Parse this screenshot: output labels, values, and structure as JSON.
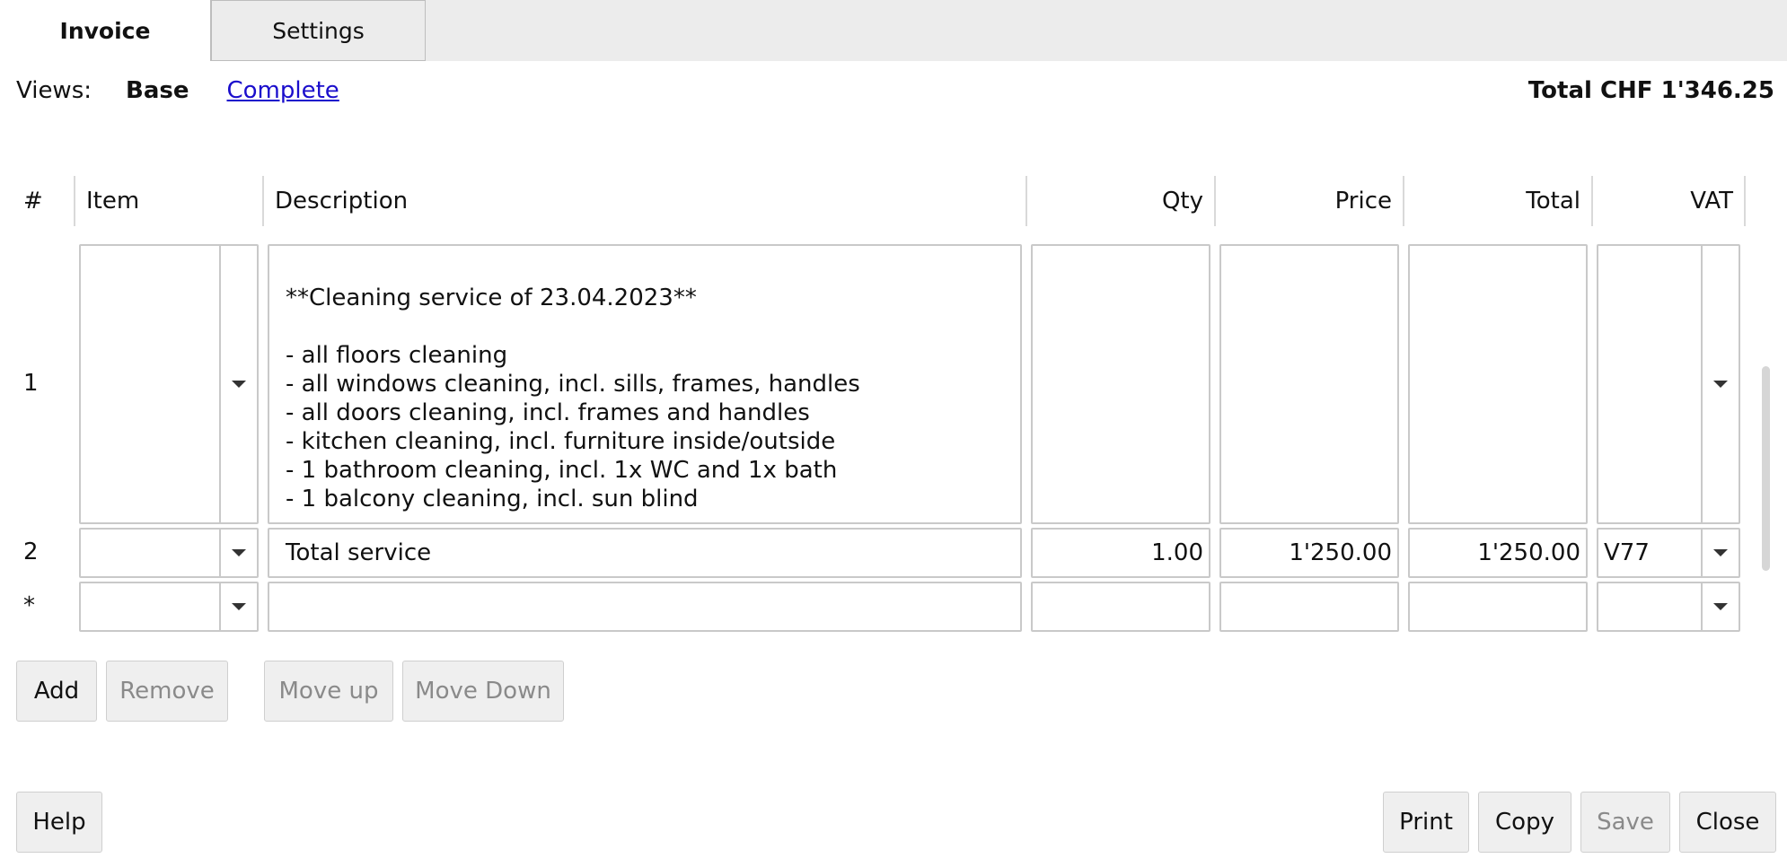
{
  "tabs": [
    {
      "label": "Invoice"
    },
    {
      "label": "Settings"
    }
  ],
  "views": {
    "label": "Views:",
    "base": "Base",
    "complete": "Complete"
  },
  "total_summary": "Total CHF 1'346.25",
  "table": {
    "headers": {
      "num": "#",
      "item": "Item",
      "description": "Description",
      "qty": "Qty",
      "price": "Price",
      "total": "Total",
      "vat": "VAT"
    },
    "rows": [
      {
        "num": "1",
        "item": "",
        "description": "**Cleaning service of 23.04.2023**\n\n- all floors cleaning\n- all windows cleaning, incl. sills, frames, handles\n- all doors cleaning, incl. frames and handles\n- kitchen cleaning, incl. furniture inside/outside\n- 1 bathroom cleaning, incl. 1x WC and 1x bath\n- 1 balcony cleaning, incl. sun blind",
        "qty": "",
        "price": "",
        "total": "",
        "vat": ""
      },
      {
        "num": "2",
        "item": "",
        "description": "Total service",
        "qty": "1.00",
        "price": "1'250.00",
        "total": "1'250.00",
        "vat": "V77"
      },
      {
        "num": "*",
        "item": "",
        "description": "",
        "qty": "",
        "price": "",
        "total": "",
        "vat": ""
      }
    ]
  },
  "row_buttons": {
    "add": "Add",
    "remove": "Remove",
    "move_up": "Move up",
    "move_down": "Move Down"
  },
  "footer_buttons": {
    "help": "Help",
    "print": "Print",
    "copy": "Copy",
    "save": "Save",
    "close": "Close"
  }
}
